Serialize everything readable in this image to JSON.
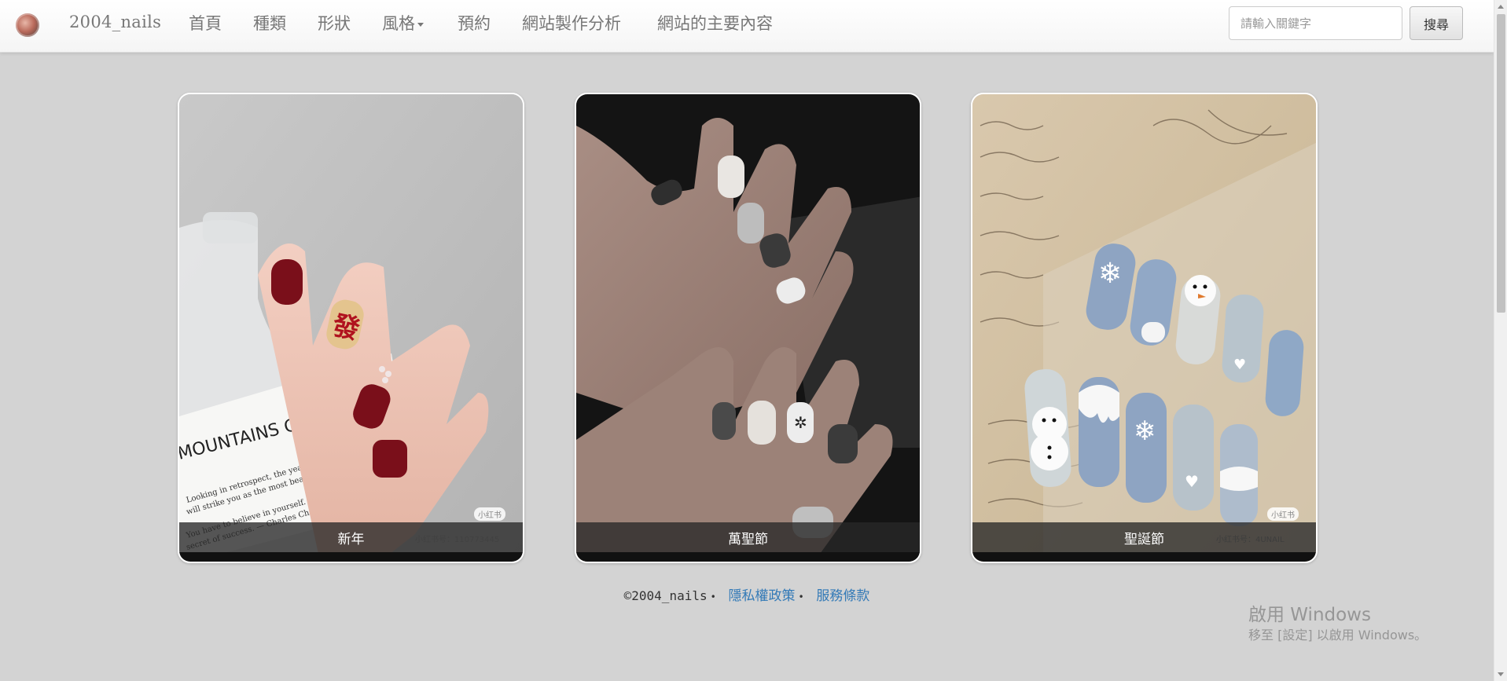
{
  "navbar": {
    "brand": "2004_nails",
    "items": [
      "首頁",
      "種類",
      "形狀",
      "風格",
      "預約",
      "網站製作分析",
      "網站的主要內容"
    ],
    "search_placeholder": "請輸入關鍵字",
    "search_button": "搜尋"
  },
  "cards": [
    {
      "caption": "新年",
      "badge": "小红书",
      "bottle_text": "MOUNTAINS CACTUS",
      "bottle_line1": "Looking in retrospect, the years of struggle",
      "bottle_line2": "will strike you as the most beautiful.",
      "bottle_line3": "You have to believe in yourself. That's the",
      "bottle_line4": "secret of success. — Charles Chaplin",
      "fa_char": "發"
    },
    {
      "caption": "萬聖節"
    },
    {
      "caption": "聖誕節",
      "badge": "小红书"
    }
  ],
  "footer": {
    "copyright": "©2004_nails",
    "separator": "•",
    "privacy": "隱私權政策",
    "terms": "服務條款"
  },
  "windows_watermark": {
    "title": "啟用 Windows",
    "subtitle": "移至 [設定] 以啟用 Windows。"
  }
}
